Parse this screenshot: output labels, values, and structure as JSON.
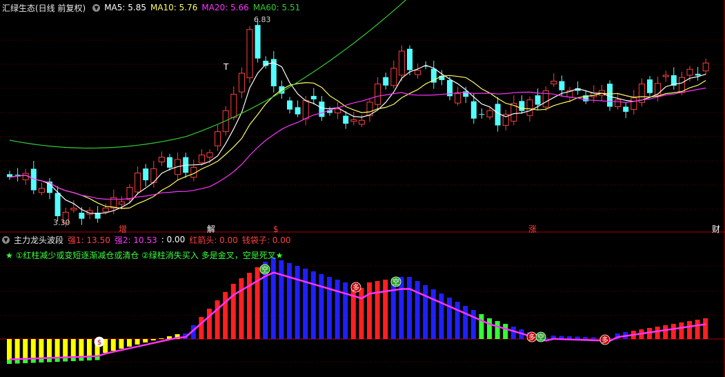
{
  "top_header": {
    "title": "汇绿生态(日线 前复权)",
    "ma": [
      {
        "label": "MA5: 5.85",
        "color": "#ffffff"
      },
      {
        "label": "MA10: 5.76",
        "color": "#ffff66"
      },
      {
        "label": "MA20: 5.66",
        "color": "#ff33ff"
      },
      {
        "label": "MA60: 5.51",
        "color": "#33cc33"
      }
    ]
  },
  "price_annotations": {
    "high": "6.83",
    "low": "3.30",
    "t_mark": "T"
  },
  "event_markers": [
    "增",
    "解",
    "$",
    "涨",
    "财"
  ],
  "bottom_header": {
    "title": "主力龙头波段",
    "values": [
      {
        "label": "强1: 13.50",
        "color": "#ff4040"
      },
      {
        "label": "强2: 10.53",
        "color": "#ff33ff"
      },
      {
        "label": ": 0.00",
        "color": "#ffffff"
      },
      {
        "label": "红箭头: 0.00",
        "color": "#ff4040"
      },
      {
        "label": "钱袋子: 0.00",
        "color": "#ff4040"
      }
    ]
  },
  "note": "★ ①红柱减少或变短逐渐减仓或清仓 ②绿柱消失买入 多是金叉，空是死叉★",
  "signal_labels": {
    "duo": "多",
    "kong": "空",
    "bag": "$"
  },
  "chart_data": {
    "type": "candlestick",
    "title": "汇绿生态(日线 前复权)",
    "price_range": [
      3.3,
      6.83
    ],
    "last_close": 6.0,
    "ma_values": {
      "MA5": 5.85,
      "MA10": 5.76,
      "MA20": 5.66,
      "MA60": 5.51
    },
    "indicator": {
      "name": "主力龙头波段",
      "强1": 13.5,
      "强2": 10.53,
      "红箭头": 0.0,
      "钱袋子": 0.0
    }
  }
}
